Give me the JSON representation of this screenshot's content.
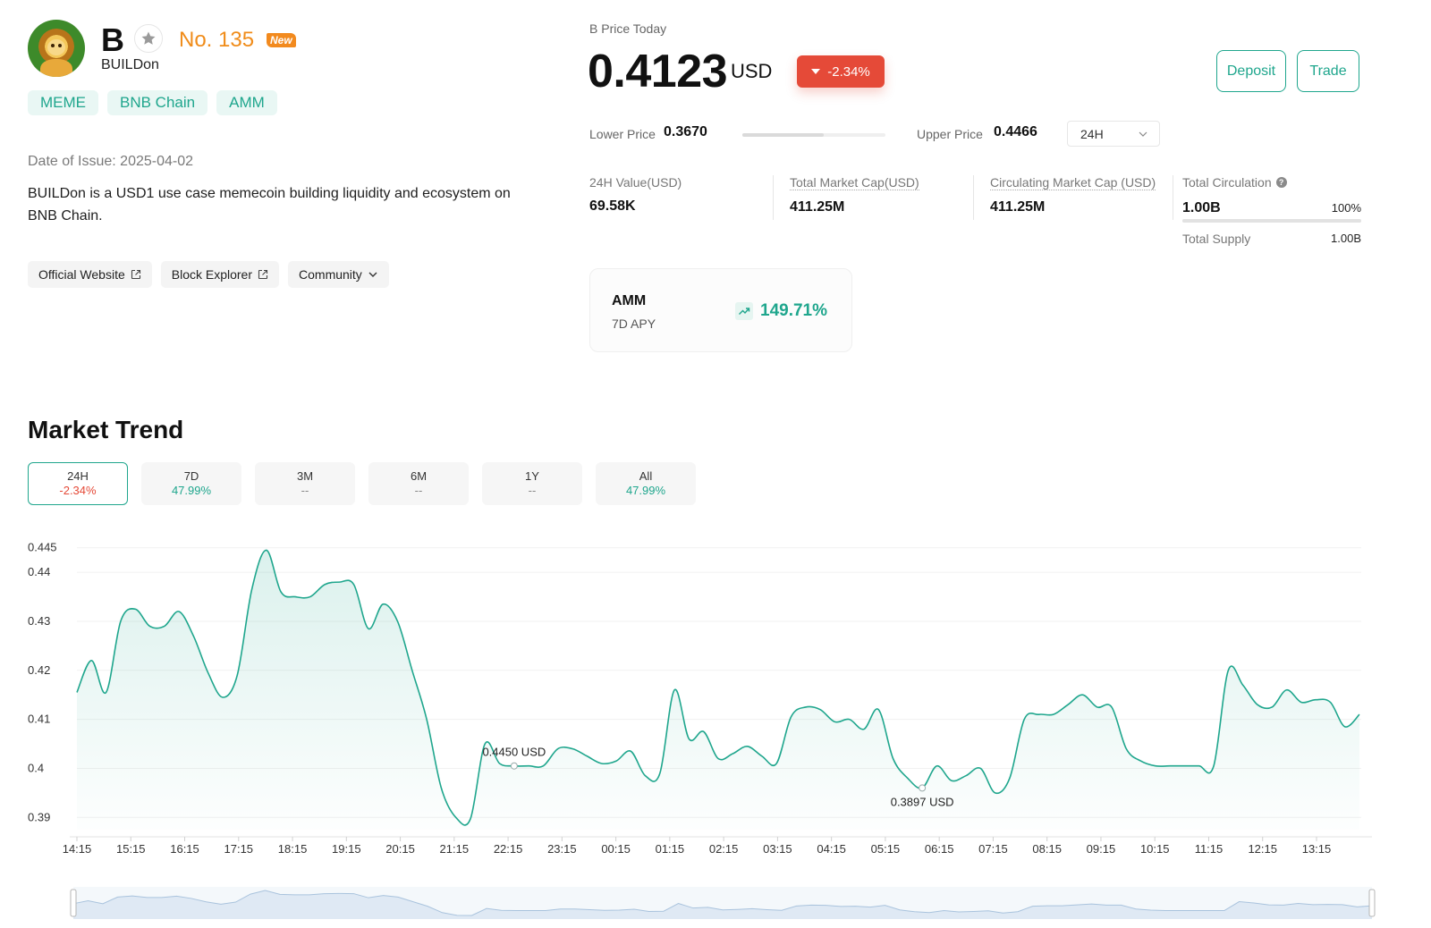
{
  "coin": {
    "ticker": "B",
    "rank": "No. 135",
    "badge": "New",
    "full_name": "BUILDon",
    "tags": [
      "MEME",
      "BNB Chain",
      "AMM"
    ],
    "issue_date": "Date of Issue: 2025-04-02",
    "description": "BUILDon is a USD1 use case memecoin building liquidity and ecosystem on BNB Chain.",
    "links": {
      "official": "Official Website",
      "explorer": "Block Explorer",
      "community": "Community"
    }
  },
  "price": {
    "label": "B Price Today",
    "value": "0.4123",
    "unit": "USD",
    "change": "-2.34%",
    "change_color": "#e54a38"
  },
  "actions": {
    "deposit": "Deposit",
    "trade": "Trade"
  },
  "range": {
    "lower_label": "Lower Price",
    "lower_value": "0.3670",
    "upper_label": "Upper Price",
    "upper_value": "0.4466",
    "current_fraction": 0.57,
    "period_selected": "24H"
  },
  "stats": {
    "value_24h_label": "24H Value(USD)",
    "value_24h": "69.58K",
    "total_mcap_label": "Total Market Cap(USD)",
    "total_mcap": "411.25M",
    "circ_mcap_label": "Circulating Market Cap (USD)",
    "circ_mcap": "411.25M",
    "total_circ_label": "Total Circulation",
    "total_circ": "1.00B",
    "total_circ_pct": "100%",
    "total_supply_label": "Total Supply",
    "total_supply": "1.00B"
  },
  "amm": {
    "title": "AMM",
    "subtitle": "7D APY",
    "apy": "149.71%"
  },
  "market_trend": {
    "title": "Market Trend",
    "tabs": [
      {
        "label": "24H",
        "change": "-2.34%",
        "tone": "neg",
        "active": true
      },
      {
        "label": "7D",
        "change": "47.99%",
        "tone": "pos",
        "active": false
      },
      {
        "label": "3M",
        "change": "--",
        "tone": "none",
        "active": false
      },
      {
        "label": "6M",
        "change": "--",
        "tone": "none",
        "active": false
      },
      {
        "label": "1Y",
        "change": "--",
        "tone": "none",
        "active": false
      },
      {
        "label": "All",
        "change": "47.99%",
        "tone": "pos",
        "active": false
      }
    ]
  },
  "colors": {
    "accent": "#1fa68d",
    "negative": "#e54a38",
    "rank": "#f08c1a"
  },
  "chart_data": {
    "type": "area",
    "y_ticks": [
      "0.39",
      "0.4",
      "0.41",
      "0.42",
      "0.43",
      "0.44",
      "0.445"
    ],
    "ylim": [
      0.3875,
      0.4455
    ],
    "x_ticks": [
      "14:15",
      "15:15",
      "16:15",
      "17:15",
      "18:15",
      "19:15",
      "20:15",
      "21:15",
      "22:15",
      "23:15",
      "00:15",
      "01:15",
      "02:15",
      "03:15",
      "04:15",
      "05:15",
      "06:15",
      "07:15",
      "08:15",
      "09:15",
      "10:15",
      "11:15",
      "12:15",
      "13:15"
    ],
    "max_label": "0.4450 USD",
    "min_label": "0.3897 USD",
    "max_index": 30,
    "min_index": 58,
    "series": [
      {
        "values": [
          0.4155,
          0.422,
          0.4155,
          0.43,
          0.4325,
          0.429,
          0.429,
          0.432,
          0.427,
          0.4195,
          0.4145,
          0.419,
          0.4365,
          0.4445,
          0.436,
          0.435,
          0.435,
          0.4375,
          0.438,
          0.4375,
          0.4285,
          0.4335,
          0.43,
          0.42,
          0.41,
          0.396,
          0.39,
          0.3897,
          0.405,
          0.401,
          0.4005,
          0.4005,
          0.4005,
          0.404,
          0.404,
          0.4025,
          0.401,
          0.4015,
          0.4035,
          0.3985,
          0.399,
          0.416,
          0.406,
          0.4075,
          0.402,
          0.403,
          0.4045,
          0.4025,
          0.401,
          0.4105,
          0.4125,
          0.412,
          0.4095,
          0.41,
          0.408,
          0.412,
          0.402,
          0.398,
          0.396,
          0.4005,
          0.3975,
          0.3985,
          0.4,
          0.395,
          0.398,
          0.41,
          0.411,
          0.411,
          0.413,
          0.415,
          0.4125,
          0.4125,
          0.404,
          0.4015,
          0.4005,
          0.4005,
          0.4005,
          0.4005,
          0.4005,
          0.42,
          0.417,
          0.413,
          0.4125,
          0.416,
          0.4135,
          0.414,
          0.4135,
          0.4085,
          0.411
        ]
      }
    ],
    "grid": true
  }
}
